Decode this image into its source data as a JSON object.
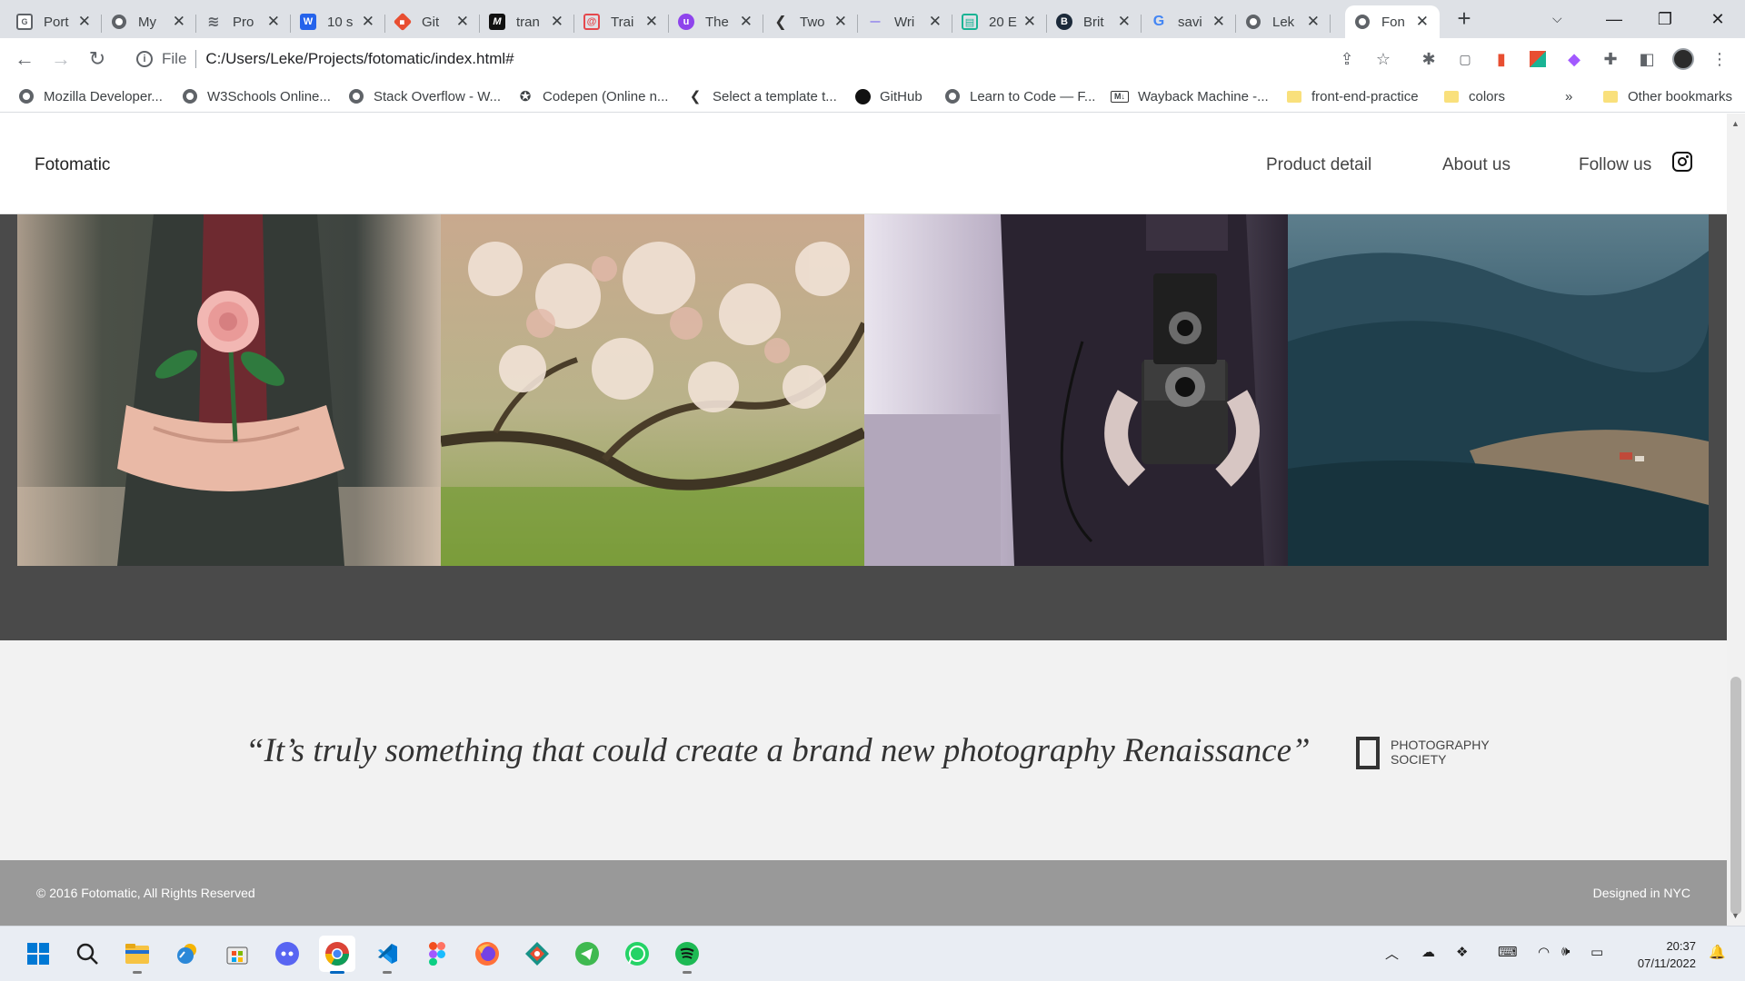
{
  "browser": {
    "tabs": [
      {
        "title": "Port",
        "icon": "dev-page-icon",
        "color": "#5f6368"
      },
      {
        "title": "My",
        "icon": "globe-icon",
        "color": "#5f6368"
      },
      {
        "title": "Pro",
        "icon": "hashnode-icon",
        "color": "#5f6368"
      },
      {
        "title": "10 s",
        "icon": "w-icon",
        "color": "#2563eb"
      },
      {
        "title": "Git",
        "icon": "git-icon",
        "color": "#e84e31"
      },
      {
        "title": "tran",
        "icon": "m-icon",
        "color": "#111111"
      },
      {
        "title": "Trai",
        "icon": "codepen-spiral-icon",
        "color": "#e5484d"
      },
      {
        "title": "The",
        "icon": "u-icon",
        "color": "#8e44ec"
      },
      {
        "title": "Two",
        "icon": "feather-icon",
        "color": "#333333"
      },
      {
        "title": "Wri",
        "icon": "dash-icon",
        "color": "#7b68ee"
      },
      {
        "title": "20 E",
        "icon": "grid-icon",
        "color": "#1ab394"
      },
      {
        "title": "Brit",
        "icon": "b-icon",
        "color": "#1c2a3a"
      },
      {
        "title": "savi",
        "icon": "google-icon",
        "color": "#4285f4"
      },
      {
        "title": "Lek",
        "icon": "globe-icon",
        "color": "#5f6368"
      },
      {
        "title": "Fon",
        "icon": "globe-icon",
        "color": "#5f6368",
        "active": true
      }
    ],
    "new_tab": "+",
    "address": {
      "scheme": "File",
      "url": "C:/Users/Leke/Projects/fotomatic/index.html#"
    },
    "bookmarks": [
      {
        "label": "Mozilla Developer...",
        "icon": "globe-icon"
      },
      {
        "label": "W3Schools Online...",
        "icon": "globe-icon"
      },
      {
        "label": "Stack Overflow - W...",
        "icon": "globe-icon"
      },
      {
        "label": "Codepen (Online n...",
        "icon": "star-icon"
      },
      {
        "label": "Select a template t...",
        "icon": "feather-icon"
      },
      {
        "label": "GitHub",
        "icon": "github-icon"
      },
      {
        "label": "Learn to Code — F...",
        "icon": "globe-icon"
      },
      {
        "label": "Wayback Machine -...",
        "icon": "md-icon"
      },
      {
        "label": "front-end-practice",
        "icon": "folder-icon"
      },
      {
        "label": "colors",
        "icon": "folder-icon"
      }
    ],
    "bookmarks_overflow": "»",
    "other_bookmarks": "Other bookmarks"
  },
  "site": {
    "logo": "Fotomatic",
    "nav": [
      "Product detail",
      "About us",
      "Follow us"
    ],
    "gallery": [
      {
        "subject": "flower-photo",
        "alt": "Person holding a pink rose"
      },
      {
        "subject": "blossom-photo",
        "alt": "Cherry blossom branches"
      },
      {
        "subject": "camera-photo",
        "alt": "Person holding a twin-lens camera"
      },
      {
        "subject": "valley-photo",
        "alt": "Forested hills and valley"
      }
    ],
    "testimonial": {
      "quote": "“It’s truly something that could create a brand new photography Renaissance”",
      "source": "PHOTOGRAPHY SOCIETY"
    },
    "footer": {
      "copyright": "© 2016 Fotomatic, All Rights Reserved",
      "credit": "Designed in NYC"
    }
  },
  "taskbar": {
    "apps": [
      "windows-start-icon",
      "search-icon",
      "file-explorer-icon",
      "weather-icon",
      "store-icon",
      "discord-icon",
      "chrome-icon",
      "vscode-icon",
      "figma-icon",
      "firefox-icon",
      "git-kraken-icon",
      "telegram-icon",
      "whatsapp-icon",
      "spotify-icon"
    ],
    "time": "20:37",
    "date": "07/11/2022"
  },
  "colors": {
    "gallery_bg": "#4a4a4a",
    "testimonial_bg": "#f2f2f2",
    "footer_bg": "#999999",
    "chrome_tabstrip": "#dee1e6"
  }
}
